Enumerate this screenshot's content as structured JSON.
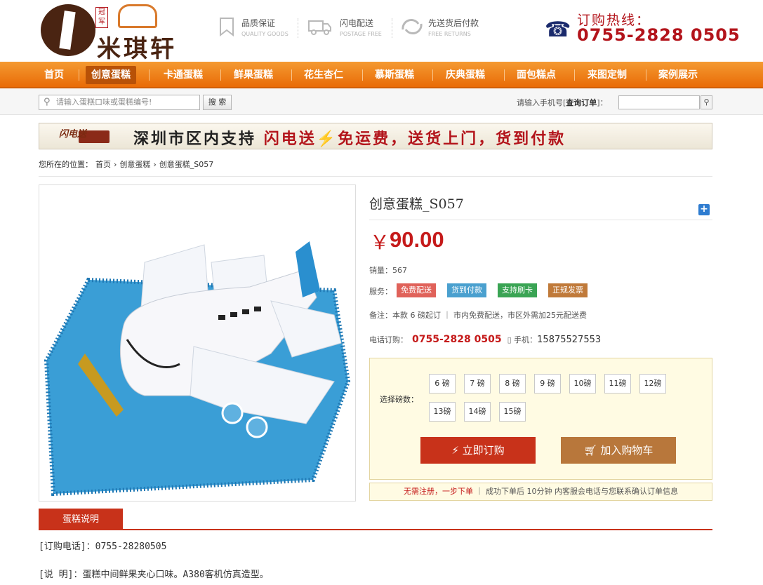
{
  "header": {
    "logo_badge": "冠军",
    "logo_name": "米琪轩",
    "promises": [
      {
        "icon": "bookmark-icon",
        "title": "品质保证",
        "sub": "QUALITY GOODS"
      },
      {
        "icon": "truck-icon",
        "title": "闪电配送",
        "sub": "POSTAGE FREE"
      },
      {
        "icon": "return-icon",
        "title": "先送货后付款",
        "sub": "FREE RETURNS"
      }
    ],
    "hotline_label": "订购热线：",
    "hotline_number": "0755-2828 0505"
  },
  "nav": [
    "首页",
    "创意蛋糕",
    "卡通蛋糕",
    "鲜果蛋糕",
    "花生杏仁",
    "慕斯蛋糕",
    "庆典蛋糕",
    "面包糕点",
    "来图定制",
    "案例展示"
  ],
  "search": {
    "placeholder": "请输入蛋糕口味或蛋糕编号!",
    "button": "搜 索",
    "order_label_pre": "请输入手机号[",
    "order_label_bold": "查询订单",
    "order_label_post": "]："
  },
  "banner": {
    "badge": "闪电送",
    "text_part1": "深圳市区内支持",
    "text_part2": "闪电送",
    "bolt": "⚡",
    "text_part3": "免运费，送货上门，货到付款"
  },
  "breadcrumb": {
    "prefix": "您所在的位置：",
    "items": [
      "首页",
      "创意蛋糕",
      "创意蛋糕_S057"
    ],
    "sep": "›"
  },
  "product": {
    "title": "创意蛋糕_S057",
    "currency": "￥",
    "price": "90.00",
    "sales_label": "销量：",
    "sales": "567",
    "service_label": "服务：",
    "services": [
      {
        "label": "免费配送",
        "color": "#e0625a"
      },
      {
        "label": "货到付款",
        "color": "#4aa0cf"
      },
      {
        "label": "支持刷卡",
        "color": "#3aa454"
      },
      {
        "label": "正规发票",
        "color": "#c07a3a"
      }
    ],
    "note": "备注：本款 6 磅起订 ｜ 市内免费配送，市区外需加25元配送费",
    "tel_label": "电话订购：",
    "tel": "0755-2828 0505",
    "mobile_label": "手机：",
    "mobile": "15875527553",
    "weight_label": "选择磅数：",
    "weights": [
      "6 磅",
      "7 磅",
      "8 磅",
      "9 磅",
      "10磅",
      "11磅",
      "12磅",
      "13磅",
      "14磅",
      "15磅"
    ],
    "buy_label": "立即订购",
    "cart_label": "加入购物车",
    "tip_red": "无需注册，一步下单",
    "tip_rest": "｜ 成功下单后 10分钟 内客服会电话与您联系确认订单信息"
  },
  "tabs": {
    "description": "蛋糕说明"
  },
  "description": {
    "phone_line": "[订购电话]：0755-28280505",
    "desc_line": "[说 明]：蛋糕中间鲜果夹心口味。A380客机仿真造型。"
  },
  "colors": {
    "accent": "#e96b06",
    "price": "#c51a1a",
    "buy": "#c8321a",
    "cart": "#b8773b"
  }
}
